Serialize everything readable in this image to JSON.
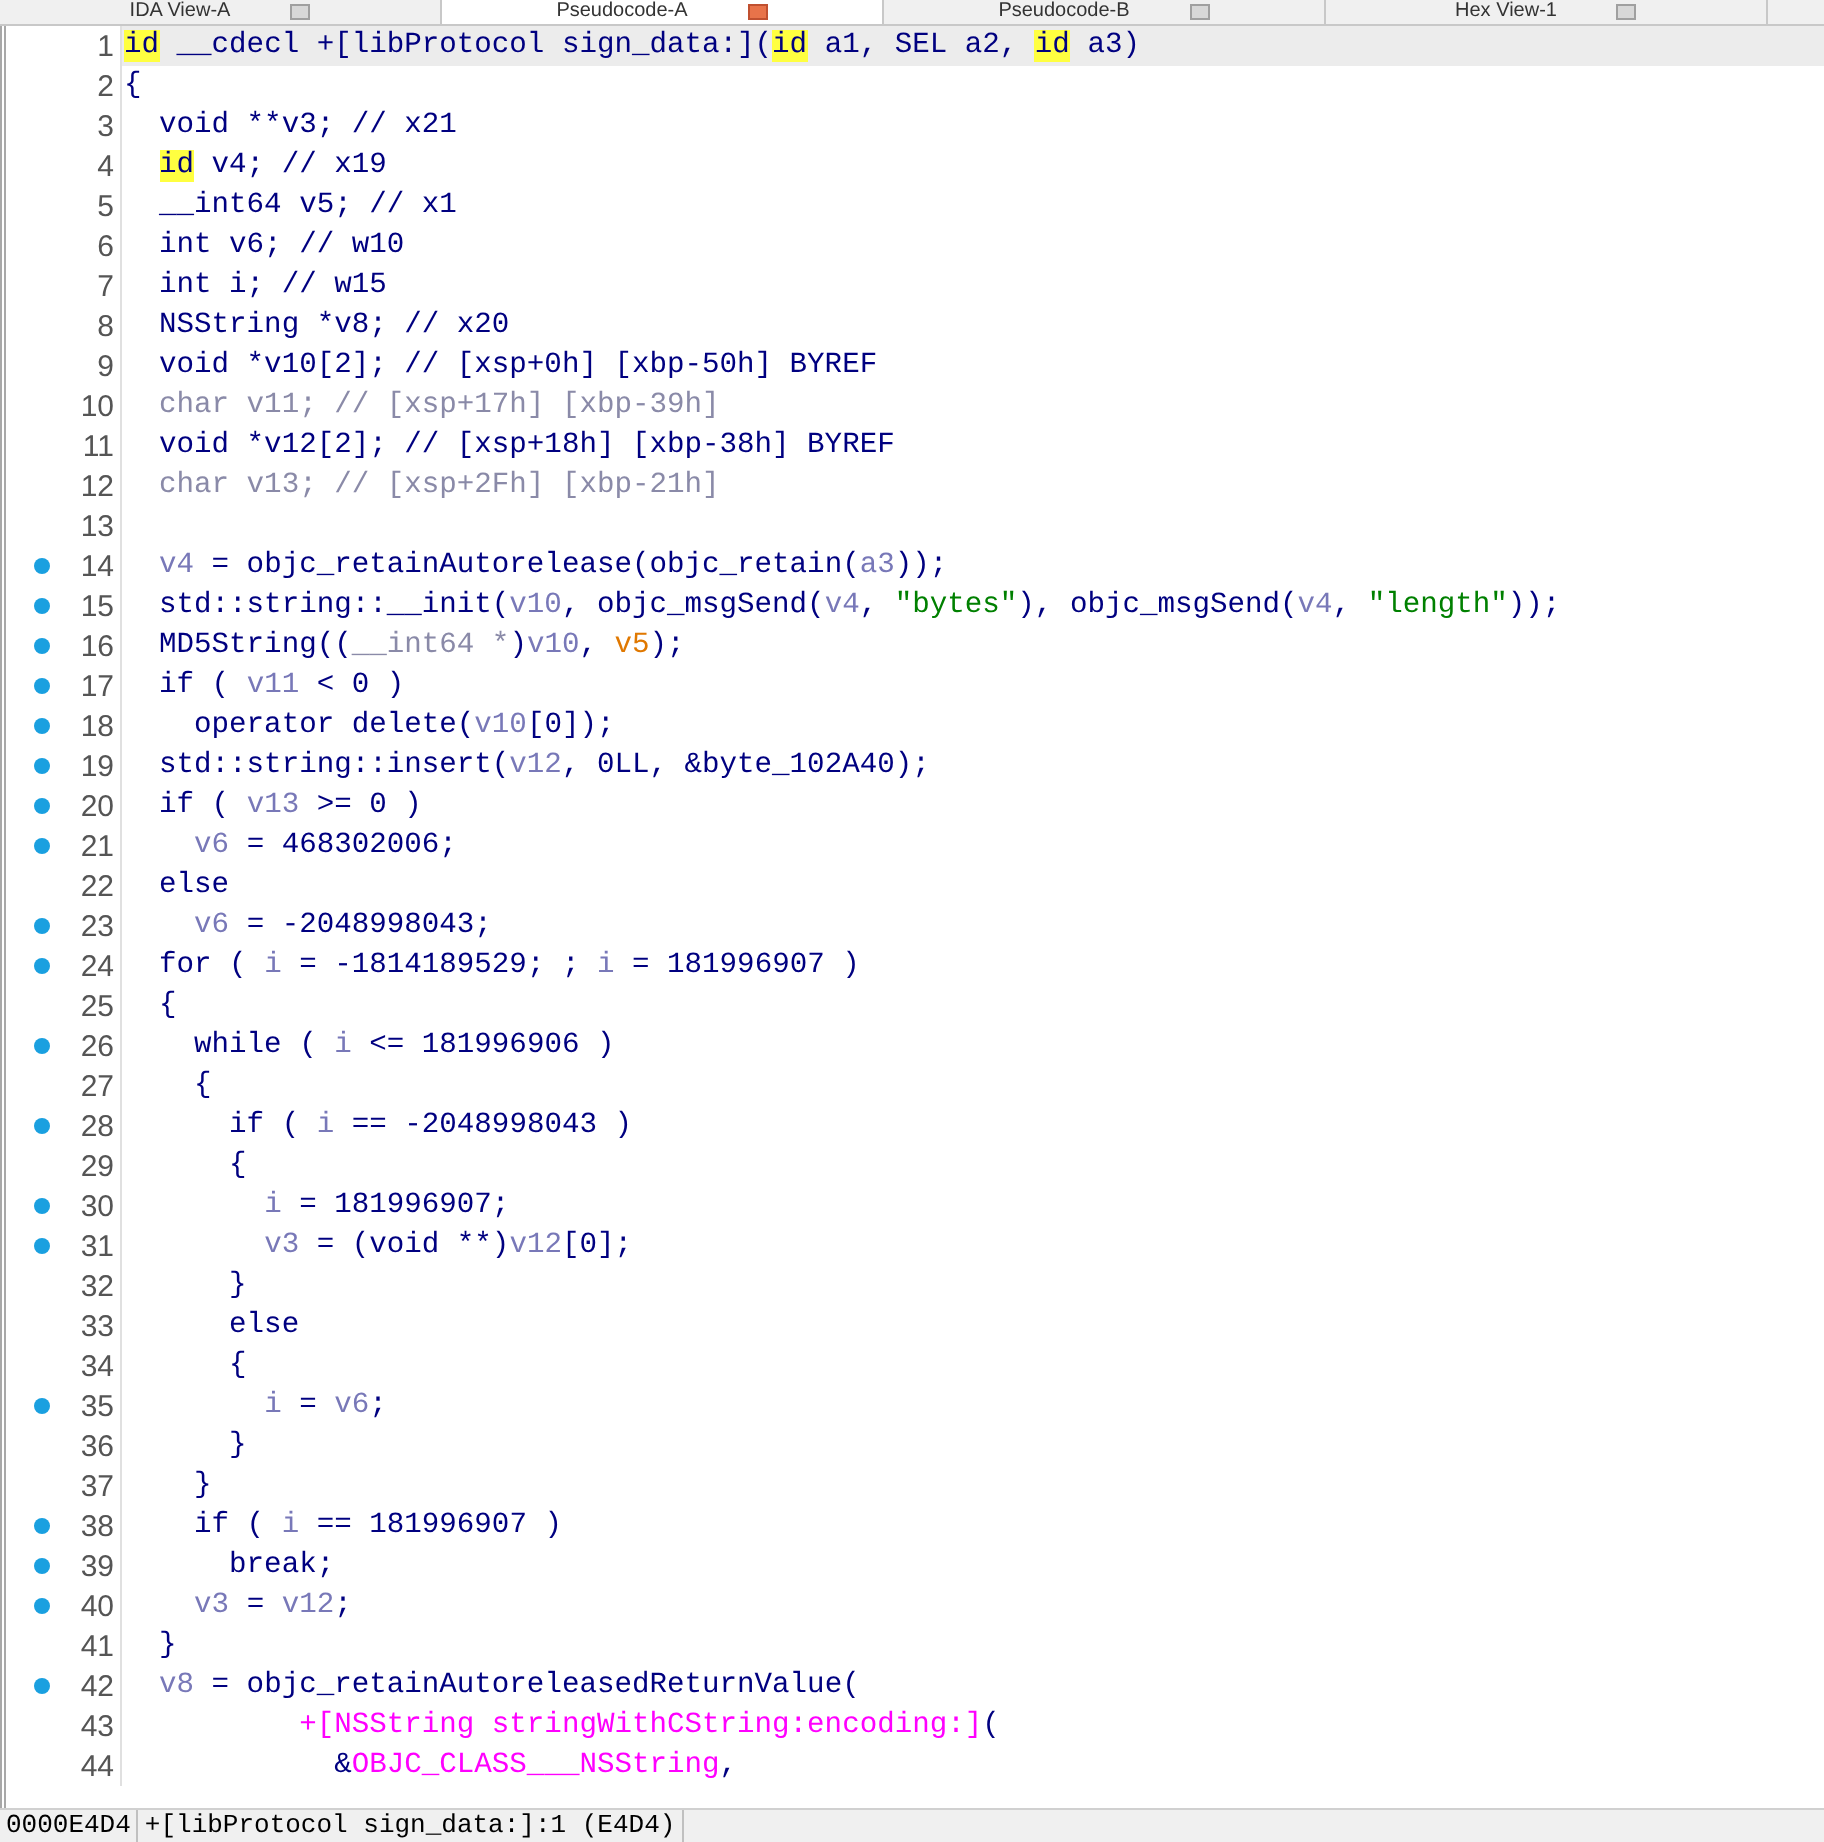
{
  "tabs": [
    {
      "label": "IDA View-A",
      "selected": false
    },
    {
      "label": "Pseudocode-A",
      "selected": true
    },
    {
      "label": "Pseudocode-B",
      "selected": false
    },
    {
      "label": "Hex View-1",
      "selected": false
    }
  ],
  "code": {
    "lines": [
      {
        "number": "1",
        "dot": false,
        "current": true,
        "tokens": [
          {
            "kind": "highlight",
            "t": "id"
          },
          {
            "kind": "plain",
            "t": " __cdecl +[libProtocol sign_data:]("
          },
          {
            "kind": "highlight",
            "t": "id"
          },
          {
            "kind": "plain",
            "t": " a1, SEL a2, "
          },
          {
            "kind": "highlight",
            "t": "id"
          },
          {
            "kind": "plain",
            "t": " a3)"
          }
        ]
      },
      {
        "number": "2",
        "dot": false,
        "current": false,
        "tokens": [
          {
            "kind": "plain",
            "t": "{"
          }
        ]
      },
      {
        "number": "3",
        "dot": false,
        "current": false,
        "tokens": [
          {
            "kind": "plain",
            "t": "  void **v3; // x21"
          }
        ]
      },
      {
        "number": "4",
        "dot": false,
        "current": false,
        "tokens": [
          {
            "kind": "highlight",
            "t": "  id"
          },
          {
            "kind": "plain",
            "t": " v4; // x19"
          }
        ]
      },
      {
        "number": "5",
        "dot": false,
        "current": false,
        "tokens": [
          {
            "kind": "plain",
            "t": "  __int64 v5; // x1"
          }
        ]
      },
      {
        "number": "6",
        "dot": false,
        "current": false,
        "tokens": [
          {
            "kind": "plain",
            "t": "  int v6; // w10"
          }
        ]
      },
      {
        "number": "7",
        "dot": false,
        "current": false,
        "tokens": [
          {
            "kind": "plain",
            "t": "  int i; // w15"
          }
        ]
      },
      {
        "number": "8",
        "dot": false,
        "current": false,
        "tokens": [
          {
            "kind": "plain",
            "t": "  NSString *v8; // x20"
          }
        ]
      },
      {
        "number": "9",
        "dot": false,
        "current": false,
        "tokens": [
          {
            "kind": "plain",
            "t": "  void *v10[2]; // [xsp+0h] [xbp-50h] BYREF"
          }
        ]
      },
      {
        "number": "10",
        "dot": false,
        "current": false,
        "tokens": [
          {
            "kind": "dim",
            "t": "  char v11; // [xsp+17h] [xbp-39h]"
          }
        ]
      },
      {
        "number": "11",
        "dot": false,
        "current": false,
        "tokens": [
          {
            "kind": "plain",
            "t": "  void *v12[2]; // [xsp+18h] [xbp-38h] BYREF"
          }
        ]
      },
      {
        "number": "12",
        "dot": false,
        "current": false,
        "tokens": [
          {
            "kind": "dim",
            "t": "  char v13; // [xsp+2Fh] [xbp-21h]"
          }
        ]
      },
      {
        "number": "13",
        "dot": false,
        "current": false
      },
      {
        "number": "14",
        "dot": true,
        "current": false,
        "tokens": [
          {
            "kind": "local",
            "t": "  v4"
          },
          {
            "kind": "plain",
            "t": " = objc_retainAutorelease(objc_retain("
          },
          {
            "kind": "local",
            "t": "a3"
          },
          {
            "kind": "plain",
            "t": "));"
          }
        ]
      },
      {
        "number": "15",
        "dot": true,
        "current": false,
        "tokens": [
          {
            "kind": "plain",
            "t": "  std::string::__init("
          },
          {
            "kind": "local",
            "t": "v10"
          },
          {
            "kind": "plain",
            "t": ", objc_msgSend("
          },
          {
            "kind": "local",
            "t": "v4"
          },
          {
            "kind": "plain",
            "t": ", "
          },
          {
            "kind": "string",
            "t": "\"bytes\""
          },
          {
            "kind": "plain",
            "t": "), objc_msgSend("
          },
          {
            "kind": "local",
            "t": "v4"
          },
          {
            "kind": "plain",
            "t": ", "
          },
          {
            "kind": "string",
            "t": "\"length\""
          },
          {
            "kind": "plain",
            "t": "));"
          }
        ]
      },
      {
        "number": "16",
        "dot": true,
        "current": false,
        "tokens": [
          {
            "kind": "plain",
            "t": "  MD5String(("
          },
          {
            "kind": "dim",
            "t": "__int64 *"
          },
          {
            "kind": "plain",
            "t": ")"
          },
          {
            "kind": "local",
            "t": "v10"
          },
          {
            "kind": "plain",
            "t": ", "
          },
          {
            "kind": "unused",
            "t": "v5"
          },
          {
            "kind": "plain",
            "t": ");"
          }
        ]
      },
      {
        "number": "17",
        "dot": true,
        "current": false,
        "tokens": [
          {
            "kind": "plain",
            "t": "  if ( "
          },
          {
            "kind": "local",
            "t": "v11"
          },
          {
            "kind": "plain",
            "t": " < 0 )"
          }
        ]
      },
      {
        "number": "18",
        "dot": true,
        "current": false,
        "tokens": [
          {
            "kind": "plain",
            "t": "    operator delete("
          },
          {
            "kind": "local",
            "t": "v10"
          },
          {
            "kind": "plain",
            "t": "[0]);"
          }
        ]
      },
      {
        "number": "19",
        "dot": true,
        "current": false,
        "tokens": [
          {
            "kind": "plain",
            "t": "  std::string::insert("
          },
          {
            "kind": "local",
            "t": "v12"
          },
          {
            "kind": "plain",
            "t": ", 0LL, &byte_102A40);"
          }
        ]
      },
      {
        "number": "20",
        "dot": true,
        "current": false,
        "tokens": [
          {
            "kind": "plain",
            "t": "  if ( "
          },
          {
            "kind": "local",
            "t": "v13"
          },
          {
            "kind": "plain",
            "t": " >= 0 )"
          }
        ]
      },
      {
        "number": "21",
        "dot": true,
        "current": false,
        "tokens": [
          {
            "kind": "local",
            "t": "    v6"
          },
          {
            "kind": "plain",
            "t": " = 468302006;"
          }
        ]
      },
      {
        "number": "22",
        "dot": false,
        "current": false,
        "tokens": [
          {
            "kind": "plain",
            "t": "  else"
          }
        ]
      },
      {
        "number": "23",
        "dot": true,
        "current": false,
        "tokens": [
          {
            "kind": "local",
            "t": "    v6"
          },
          {
            "kind": "plain",
            "t": " = -2048998043;"
          }
        ]
      },
      {
        "number": "24",
        "dot": true,
        "current": false,
        "tokens": [
          {
            "kind": "plain",
            "t": "  for ( "
          },
          {
            "kind": "local",
            "t": "i"
          },
          {
            "kind": "plain",
            "t": " = -1814189529; ; "
          },
          {
            "kind": "local",
            "t": "i"
          },
          {
            "kind": "plain",
            "t": " = 181996907 )"
          }
        ]
      },
      {
        "number": "25",
        "dot": false,
        "current": false,
        "tokens": [
          {
            "kind": "plain",
            "t": "  {"
          }
        ]
      },
      {
        "number": "26",
        "dot": true,
        "current": false,
        "tokens": [
          {
            "kind": "plain",
            "t": "    while ( "
          },
          {
            "kind": "local",
            "t": "i"
          },
          {
            "kind": "plain",
            "t": " <= 181996906 )"
          }
        ]
      },
      {
        "number": "27",
        "dot": false,
        "current": false,
        "tokens": [
          {
            "kind": "plain",
            "t": "    {"
          }
        ]
      },
      {
        "number": "28",
        "dot": true,
        "current": false,
        "tokens": [
          {
            "kind": "plain",
            "t": "      if ( "
          },
          {
            "kind": "local",
            "t": "i"
          },
          {
            "kind": "plain",
            "t": " == -2048998043 )"
          }
        ]
      },
      {
        "number": "29",
        "dot": false,
        "current": false,
        "tokens": [
          {
            "kind": "plain",
            "t": "      {"
          }
        ]
      },
      {
        "number": "30",
        "dot": true,
        "current": false,
        "tokens": [
          {
            "kind": "local",
            "t": "        i"
          },
          {
            "kind": "plain",
            "t": " = 181996907;"
          }
        ]
      },
      {
        "number": "31",
        "dot": true,
        "current": false,
        "tokens": [
          {
            "kind": "local",
            "t": "        v3"
          },
          {
            "kind": "plain",
            "t": " = (void **)"
          },
          {
            "kind": "local",
            "t": "v12"
          },
          {
            "kind": "plain",
            "t": "[0];"
          }
        ]
      },
      {
        "number": "32",
        "dot": false,
        "current": false,
        "tokens": [
          {
            "kind": "plain",
            "t": "      }"
          }
        ]
      },
      {
        "number": "33",
        "dot": false,
        "current": false,
        "tokens": [
          {
            "kind": "plain",
            "t": "      else"
          }
        ]
      },
      {
        "number": "34",
        "dot": false,
        "current": false,
        "tokens": [
          {
            "kind": "plain",
            "t": "      {"
          }
        ]
      },
      {
        "number": "35",
        "dot": true,
        "current": false,
        "tokens": [
          {
            "kind": "local",
            "t": "        i"
          },
          {
            "kind": "plain",
            "t": " = "
          },
          {
            "kind": "local",
            "t": "v6"
          },
          {
            "kind": "plain",
            "t": ";"
          }
        ]
      },
      {
        "number": "36",
        "dot": false,
        "current": false,
        "tokens": [
          {
            "kind": "plain",
            "t": "      }"
          }
        ]
      },
      {
        "number": "37",
        "dot": false,
        "current": false,
        "tokens": [
          {
            "kind": "plain",
            "t": "    }"
          }
        ]
      },
      {
        "number": "38",
        "dot": true,
        "current": false,
        "tokens": [
          {
            "kind": "plain",
            "t": "    if ( "
          },
          {
            "kind": "local",
            "t": "i"
          },
          {
            "kind": "plain",
            "t": " == 181996907 )"
          }
        ]
      },
      {
        "number": "39",
        "dot": true,
        "current": false,
        "tokens": [
          {
            "kind": "plain",
            "t": "      break;"
          }
        ]
      },
      {
        "number": "40",
        "dot": true,
        "current": false,
        "tokens": [
          {
            "kind": "local",
            "t": "    v3"
          },
          {
            "kind": "plain",
            "t": " = "
          },
          {
            "kind": "local",
            "t": "v12"
          },
          {
            "kind": "plain",
            "t": ";"
          }
        ]
      },
      {
        "number": "41",
        "dot": false,
        "current": false,
        "tokens": [
          {
            "kind": "plain",
            "t": "  }"
          }
        ]
      },
      {
        "number": "42",
        "dot": true,
        "current": false,
        "tokens": [
          {
            "kind": "local",
            "t": "  v8"
          },
          {
            "kind": "plain",
            "t": " = objc_retainAutoreleasedReturnValue("
          }
        ]
      },
      {
        "number": "43",
        "dot": false,
        "current": false,
        "tokens": [
          {
            "kind": "symbol",
            "t": "          +[NSString stringWithCString:encoding:]"
          },
          {
            "kind": "plain",
            "t": "("
          }
        ]
      },
      {
        "number": "44",
        "dot": false,
        "current": false,
        "tokens": [
          {
            "kind": "plain",
            "t": "            &"
          },
          {
            "kind": "symbol",
            "t": "OBJC_CLASS___NSString"
          },
          {
            "kind": "plain",
            "t": ","
          }
        ]
      }
    ]
  },
  "status_bar": {
    "address": "0000E4D4",
    "location": "+[libProtocol sign_data:]:1 (E4D4)"
  }
}
